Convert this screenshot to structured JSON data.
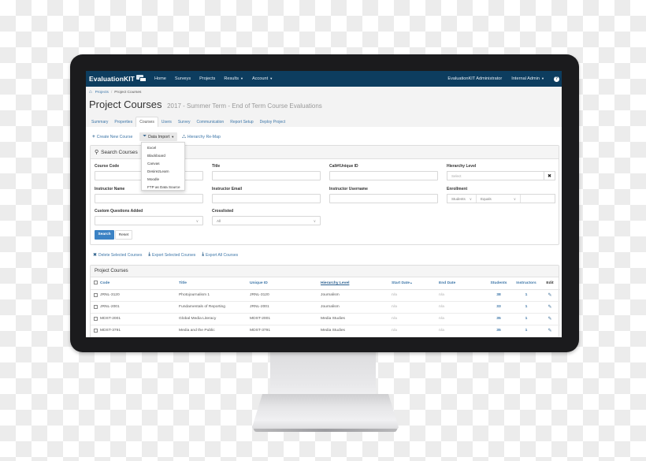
{
  "app": {
    "brand": "EvaluationKIT",
    "nav": [
      {
        "label": "Home",
        "dropdown": false
      },
      {
        "label": "Surveys",
        "dropdown": false
      },
      {
        "label": "Projects",
        "dropdown": false
      },
      {
        "label": "Results",
        "dropdown": true
      },
      {
        "label": "Account",
        "dropdown": true
      }
    ],
    "user_label": "EvaluationKIT Administrator",
    "role_label": "Internal Admin",
    "help_glyph": "?"
  },
  "breadcrumb": {
    "home_icon": "home-icon",
    "items": [
      "Projects",
      "Project Courses"
    ]
  },
  "page": {
    "title": "Project Courses",
    "subtitle": "2017 - Summer Term - End of Term Course Evaluations"
  },
  "tabs": [
    {
      "label": "Summary",
      "active": false
    },
    {
      "label": "Properties",
      "active": false
    },
    {
      "label": "Courses",
      "active": true
    },
    {
      "label": "Users",
      "active": false
    },
    {
      "label": "Survey",
      "active": false
    },
    {
      "label": "Communication",
      "active": false
    },
    {
      "label": "Report Setup",
      "active": false
    },
    {
      "label": "Deploy Project",
      "active": false
    }
  ],
  "toolbar": {
    "create_label": "Create New Course",
    "import_label": "Data Import",
    "remap_label": "Hierarchy Re-Map"
  },
  "import_menu": [
    "Excel",
    "Blackboard",
    "Canvas",
    "Desire2Learn",
    "Moodle",
    "FTP as Data Source"
  ],
  "search": {
    "heading": "Search Courses",
    "fields": {
      "course_code": {
        "label": "Course Code",
        "value": ""
      },
      "title": {
        "label": "Title",
        "value": ""
      },
      "unique_id": {
        "label": "Call#/Unique ID",
        "value": ""
      },
      "hierarchy": {
        "label": "Hierarchy Level",
        "placeholder": "Select",
        "clear_glyph": "✖"
      },
      "instructor_name": {
        "label": "Instructor Name",
        "value": ""
      },
      "instructor_email": {
        "label": "Instructor Email",
        "value": ""
      },
      "instructor_username": {
        "label": "Instructor Username",
        "value": ""
      },
      "enrollment": {
        "label": "Enrollment",
        "subject": "Students",
        "operator": "Equals",
        "value": ""
      },
      "custom_questions": {
        "label": "Custom Questions Added",
        "value": ""
      },
      "crosslisted": {
        "label": "Crosslisted",
        "value": "All"
      }
    },
    "search_button": "Search",
    "reset_button": "Reset"
  },
  "actions": {
    "delete_label": "Delete Selected Courses",
    "export_selected_label": "Export Selected Courses",
    "export_all_label": "Export All Courses"
  },
  "courses_table": {
    "heading": "Project Courses",
    "columns": [
      "Code",
      "Title",
      "Unique ID",
      "Hierarchy Level",
      "Start Date",
      "End Date",
      "Students",
      "Instructors",
      "Edit"
    ],
    "sort_indicator": "▲",
    "rows": [
      {
        "code": "JRNL-3120",
        "title": "Photojournalism 1",
        "unique_id": "JRNL-3120",
        "hierarchy": "Journalism",
        "start": "n/a",
        "end": "n/a",
        "students": "38",
        "instructors": "1"
      },
      {
        "code": "JRNL-2001",
        "title": "Fundamentals of Reporting",
        "unique_id": "JRNL-2001",
        "hierarchy": "Journalism",
        "start": "n/a",
        "end": "n/a",
        "students": "33",
        "instructors": "1"
      },
      {
        "code": "MDST-2001",
        "title": "Global Media Literacy",
        "unique_id": "MDST-2001",
        "hierarchy": "Media Studies",
        "start": "n/a",
        "end": "n/a",
        "students": "35",
        "instructors": "1"
      },
      {
        "code": "MDST-3791",
        "title": "Media and the Public",
        "unique_id": "MDST-3791",
        "hierarchy": "Media Studies",
        "start": "n/a",
        "end": "n/a",
        "students": "35",
        "instructors": "1"
      }
    ]
  },
  "colors": {
    "navbar": "#0d3d5f",
    "link": "#3d76a8",
    "primary_button": "#3b82c4",
    "bezel": "#1b1b1d"
  }
}
